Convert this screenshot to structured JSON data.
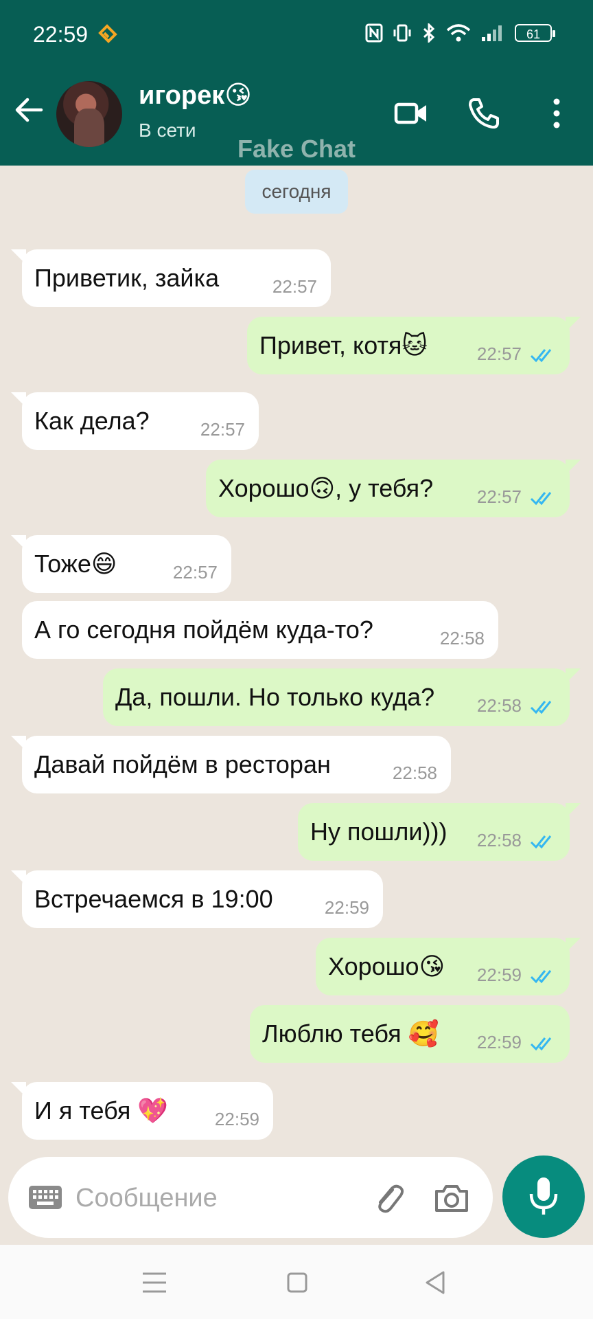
{
  "status_bar": {
    "time": "22:59",
    "battery": "61"
  },
  "header": {
    "contact_name": "игорек😘",
    "contact_status": "В сети",
    "watermark": "Fake Chat"
  },
  "chat": {
    "date_label": "сегодня",
    "messages": [
      {
        "dir": "in",
        "text": "Приветик, зайка",
        "time": "22:57"
      },
      {
        "dir": "out",
        "text": "Привет, котя🐱",
        "time": "22:57",
        "read": true
      },
      {
        "dir": "in",
        "text": "Как дела?",
        "time": "22:57"
      },
      {
        "dir": "out",
        "text": "Хорошо🙃, у тебя?",
        "time": "22:57",
        "read": true
      },
      {
        "dir": "in",
        "text": "Тоже😄",
        "time": "22:57"
      },
      {
        "dir": "in",
        "text": "А го сегодня пойдём куда-то?",
        "time": "22:58"
      },
      {
        "dir": "out",
        "text": "Да, пошли. Но только куда?",
        "time": "22:58",
        "read": true
      },
      {
        "dir": "in",
        "text": "Давай пойдём в ресторан",
        "time": "22:58"
      },
      {
        "dir": "out",
        "text": "Ну пошли)))",
        "time": "22:58",
        "read": true
      },
      {
        "dir": "in",
        "text": "Встречаемся в 19:00",
        "time": "22:59"
      },
      {
        "dir": "out",
        "text": "Хорошо😘",
        "time": "22:59",
        "read": true
      },
      {
        "dir": "out",
        "text": "Люблю тебя 🥰",
        "time": "22:59",
        "read": true
      },
      {
        "dir": "in",
        "text": "И я тебя 💖",
        "time": "22:59"
      }
    ]
  },
  "input": {
    "placeholder": "Сообщение"
  },
  "colors": {
    "header": "#075E54",
    "outgoing": "#DCF8C6",
    "incoming": "#FFFFFF",
    "accent": "#078C7E",
    "tick": "#34B7F1"
  }
}
